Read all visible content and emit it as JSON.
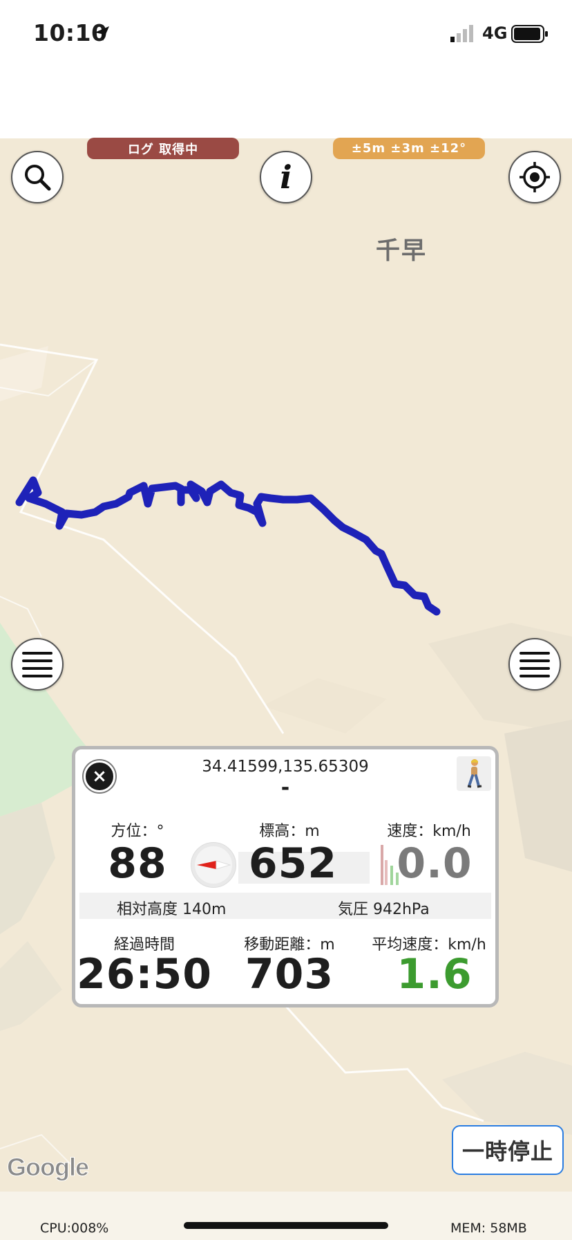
{
  "status_bar": {
    "time": "10:10",
    "network": "4G"
  },
  "badges": {
    "logging": "ログ 取得中",
    "accuracy": "±5m ±3m ±12°"
  },
  "map": {
    "place_label": "千早",
    "attribution": "Google",
    "track_color": "#1e22b8"
  },
  "buttons": {
    "info_label": "i",
    "pause_label": "一時停止"
  },
  "panel": {
    "coordinates": "34.41599,135.65309",
    "place_name": "-",
    "bearing_label": "方位：°",
    "bearing_value": "88",
    "elevation_label": "標高：m",
    "elevation_value": "652",
    "speed_label": "速度：km/h",
    "speed_value": "0.0",
    "relative_height": "相対高度 140m",
    "pressure": "気圧 942hPa",
    "elapsed_label": "経過時間",
    "elapsed_value": "26:50",
    "distance_label": "移動距離：m",
    "distance_value": "703",
    "avg_speed_label": "平均速度：km/h",
    "avg_speed_value": "1.6",
    "avg_speed_color": "#3c9b2f",
    "speed_value_color": "#7a7a7a",
    "close_symbol": "×"
  },
  "footer": {
    "cpu": "CPU:008%",
    "mem": "MEM: 58MB"
  },
  "icons": [
    "location-arrow-icon",
    "signal-icon",
    "battery-icon",
    "search-icon",
    "info-icon",
    "locate-icon",
    "menu-icon",
    "compass-icon",
    "walking-person-icon",
    "close-icon"
  ]
}
